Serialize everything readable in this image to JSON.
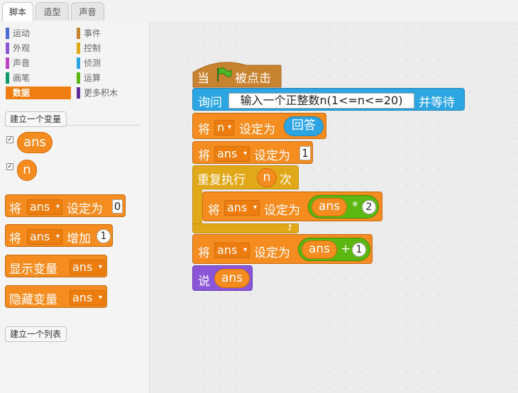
{
  "tabs": [
    "脚本",
    "造型",
    "声音"
  ],
  "categories": [
    {
      "label": "运动",
      "color": "#4a6cd4"
    },
    {
      "label": "事件",
      "color": "#c88330"
    },
    {
      "label": "外观",
      "color": "#8a55d7"
    },
    {
      "label": "控制",
      "color": "#e1a91a"
    },
    {
      "label": "声音",
      "color": "#bb42c3"
    },
    {
      "label": "侦测",
      "color": "#2ca5e2"
    },
    {
      "label": "画笔",
      "color": "#0e9a6c"
    },
    {
      "label": "运算",
      "color": "#5cb712"
    },
    {
      "label": "数据",
      "color": "#ee7d16"
    },
    {
      "label": "更多积木",
      "color": "#632d99"
    }
  ],
  "palette": {
    "make_variable": "建立一个变量",
    "make_list": "建立一个列表",
    "var1": "ans",
    "var2": "n",
    "block_set": {
      "pre": "将",
      "var": "ans",
      "post": "设定为",
      "value": "0"
    },
    "block_change": {
      "pre": "将",
      "var": "ans",
      "post": "增加",
      "value": "1"
    },
    "block_show": {
      "label": "显示变量",
      "var": "ans"
    },
    "block_hide": {
      "label": "隐藏变量",
      "var": "ans"
    }
  },
  "script": {
    "hat": {
      "pre": "当",
      "post": "被点击"
    },
    "ask": {
      "pre": "询问",
      "question": "输入一个正整数n(1<=n<=20)",
      "post": "并等待"
    },
    "set_n": {
      "pre": "将",
      "var": "n",
      "post": "设定为",
      "value": "回答"
    },
    "set_ans": {
      "pre": "将",
      "var": "ans",
      "post": "设定为",
      "value": "1"
    },
    "repeat": {
      "pre": "重复执行",
      "var": "n",
      "post": "次"
    },
    "inner": {
      "pre": "将",
      "var": "ans",
      "post": "设定为",
      "op_var": "ans",
      "op": "*",
      "op_val": "2"
    },
    "set_plus": {
      "pre": "将",
      "var": "ans",
      "post": "设定为",
      "op_var": "ans",
      "op": "+",
      "op_val": "1"
    },
    "say": {
      "pre": "说",
      "var": "ans"
    }
  }
}
